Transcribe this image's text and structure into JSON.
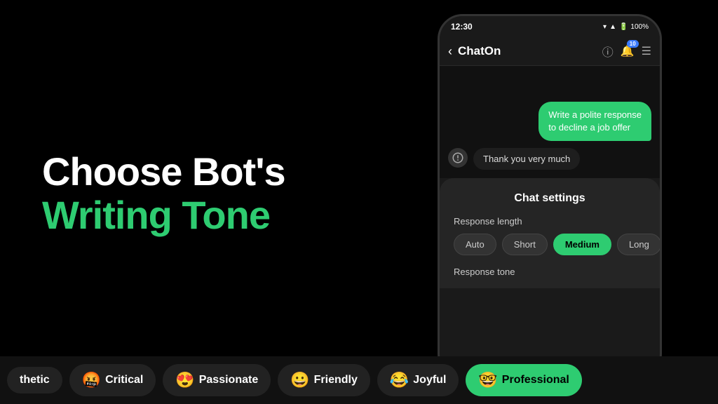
{
  "left": {
    "line1": "Choose Bot's",
    "line2": "Writing Tone"
  },
  "phone": {
    "statusBar": {
      "time": "12:30",
      "icons": "▾ ▲ 🔋 100%"
    },
    "header": {
      "backLabel": "‹",
      "title": "ChatOn",
      "notificationCount": "10"
    },
    "messages": [
      {
        "type": "user",
        "text": "Write a polite response to decline a job offer"
      },
      {
        "type": "bot",
        "text": "Thank you very much"
      }
    ],
    "settings": {
      "title": "Chat settings",
      "responseLengthLabel": "Response length",
      "buttons": [
        "Auto",
        "Short",
        "Medium",
        "Long"
      ],
      "activeButton": "Medium",
      "responseToneLabel": "Response tone"
    }
  },
  "toneBar": {
    "items": [
      {
        "emoji": "",
        "label": "thetic",
        "active": false,
        "partial": true
      },
      {
        "emoji": "🤬",
        "label": "Critical",
        "active": false
      },
      {
        "emoji": "😍",
        "label": "Passionate",
        "active": false
      },
      {
        "emoji": "😀",
        "label": "Friendly",
        "active": false
      },
      {
        "emoji": "😂",
        "label": "Joyful",
        "active": false
      },
      {
        "emoji": "🤓",
        "label": "Professional",
        "active": true
      }
    ]
  },
  "colors": {
    "accent": "#2ecc71",
    "bg": "#000000",
    "phoneBg": "#1a1a1a",
    "settingsBg": "#252525"
  }
}
